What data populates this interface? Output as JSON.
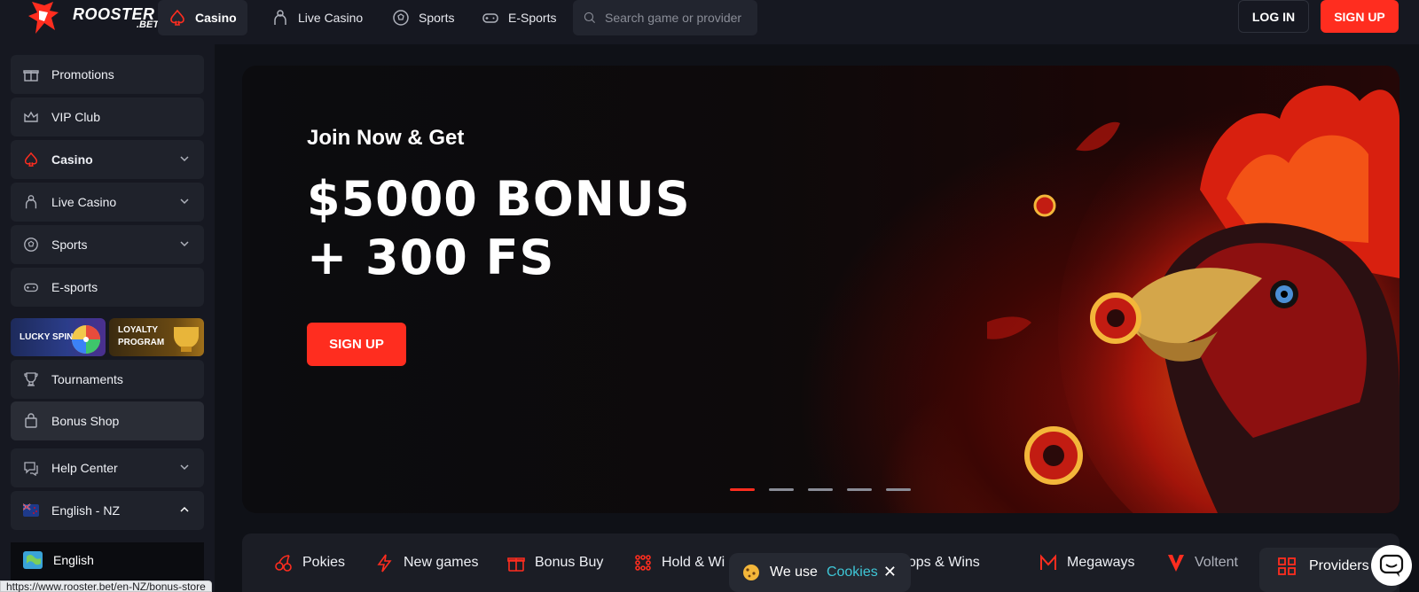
{
  "brand": {
    "name": "ROOSTER",
    "sub": ".BET"
  },
  "nav": {
    "items": [
      {
        "label": "Casino",
        "icon": "spade-icon",
        "active": true
      },
      {
        "label": "Live Casino",
        "icon": "dealer-icon",
        "active": false
      },
      {
        "label": "Sports",
        "icon": "soccer-ball-icon",
        "active": false
      },
      {
        "label": "E-Sports",
        "icon": "gamepad-icon",
        "active": false
      }
    ],
    "search_placeholder": "Search game or provider",
    "login_label": "LOG IN",
    "signup_label": "SIGN UP"
  },
  "sidebar": {
    "items": [
      {
        "label": "Promotions",
        "icon": "gift-icon"
      },
      {
        "label": "VIP Club",
        "icon": "crown-icon"
      },
      {
        "label": "Casino",
        "icon": "spade-icon",
        "expandable": true
      },
      {
        "label": "Live Casino",
        "icon": "dealer-icon",
        "expandable": true
      },
      {
        "label": "Sports",
        "icon": "soccer-ball-icon",
        "expandable": true
      },
      {
        "label": "E-sports",
        "icon": "gamepad-icon"
      },
      {
        "label": "Tournaments",
        "icon": "trophy-icon"
      },
      {
        "label": "Bonus Shop",
        "icon": "shopping-bag-icon"
      },
      {
        "label": "Help Center",
        "icon": "chat-help-icon",
        "expandable": true
      },
      {
        "label": "English - NZ",
        "icon": "nz-flag-icon",
        "expanded": true
      }
    ],
    "tiles": [
      {
        "label": "LUCKY SPIN"
      },
      {
        "label_line1": "LOYALTY",
        "label_line2": "PROGRAM"
      }
    ],
    "language_option": "English"
  },
  "hero": {
    "pretitle": "Join Now & Get",
    "title_line1": "$5000 BONUS",
    "title_line2": "+ 300 FS",
    "cta": "SIGN UP",
    "slides": 5,
    "active_slide": 1
  },
  "categories": [
    {
      "label": "Pokies",
      "icon": "cherry-icon"
    },
    {
      "label": "New games",
      "icon": "lightning-icon"
    },
    {
      "label": "Bonus Buy",
      "icon": "gift-box-icon"
    },
    {
      "label": "Hold & Wi",
      "icon": "grid-dots-icon"
    },
    {
      "label": "Drops & Wins",
      "icon": "drops-icon"
    },
    {
      "label": "Megaways",
      "icon": "megaways-icon"
    },
    {
      "label": "Voltent",
      "icon": "voltent-v-icon"
    }
  ],
  "providers_label": "Providers",
  "cookie": {
    "text": "We use",
    "link": "Cookies",
    "close": "✕"
  },
  "status_url": "https://www.rooster.bet/en-NZ/bonus-store",
  "colors": {
    "accent": "#ff2d1f",
    "bg": "#0f1117",
    "panel": "#1f222b",
    "link": "#3ec6d6"
  }
}
